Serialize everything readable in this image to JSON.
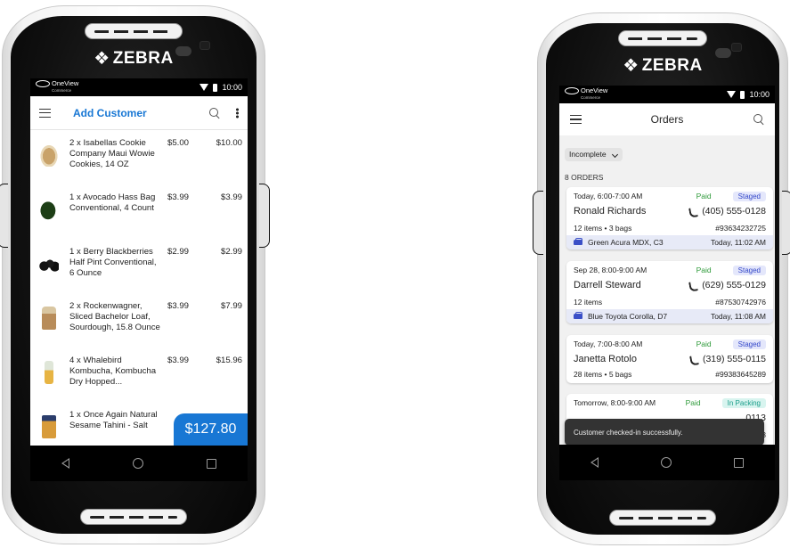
{
  "brand": "ZEBRA",
  "status": {
    "logo_text": "OneView",
    "logo_sub": "Commerce",
    "time": "10:00"
  },
  "left": {
    "title": "Add Customer",
    "items": [
      {
        "thumb": "cookie-package",
        "name": "2 x Isabellas Cookie Company Maui Wowie Cookies, 14 OZ",
        "price": "$5.00",
        "total": "$10.00"
      },
      {
        "thumb": "avocado",
        "name": "1 x Avocado Hass Bag Conventional, 4 Count",
        "price": "$3.99",
        "total": "$3.99"
      },
      {
        "thumb": "blackberries",
        "name": "1 x Berry Blackberries Half Pint Conventional, 6 Ounce",
        "price": "$2.99",
        "total": "$2.99"
      },
      {
        "thumb": "bread-loaf",
        "name": "2 x Rockenwagner, Sliced Bachelor Loaf, Sourdough, 15.8 Ounce",
        "price": "$3.99",
        "total": "$7.99"
      },
      {
        "thumb": "kombucha-bottle",
        "name": "4 x Whalebird Kombucha, Kombucha Dry Hopped...",
        "price": "$3.99",
        "total": "$15.96"
      },
      {
        "thumb": "tahini-jar",
        "name": "1 x Once Again Natural Sesame Tahini - Salt",
        "price": "",
        "total": ""
      }
    ],
    "order_total": "$127.80"
  },
  "right": {
    "title": "Orders",
    "filter": "Incomplete",
    "orders_count": "8 ORDERS",
    "orders": [
      {
        "slot": "Today, 6:00-7:00 AM",
        "paid": "Paid",
        "status": "Staged",
        "name": "Ronald Richards",
        "phone": "(405) 555-0128",
        "items": "12 items • 3 bags",
        "order_no": "#93634232725",
        "vehicle": "Green Acura MDX, C3",
        "arrival": "Today, 11:02 AM"
      },
      {
        "slot": "Sep 28, 8:00-9:00 AM",
        "paid": "Paid",
        "status": "Staged",
        "name": "Darrell Steward",
        "phone": "(629) 555-0129",
        "items": "12 items",
        "order_no": "#87530742976",
        "vehicle": "Blue Toyota Corolla, D7",
        "arrival": "Today, 11:08 AM"
      },
      {
        "slot": "Today, 7:00-8:00 AM",
        "paid": "Paid",
        "status": "Staged",
        "name": "Janetta Rotolo",
        "phone": "(319) 555-0115",
        "items": "28 items • 5 bags",
        "order_no": "#99383645289"
      },
      {
        "slot": "Tomorrow, 8:00-9:00 AM",
        "paid": "Paid",
        "status": "In Packing",
        "phone_partial": "0113",
        "order_partial": "53103"
      }
    ],
    "toast": "Customer checked-in successfully."
  }
}
